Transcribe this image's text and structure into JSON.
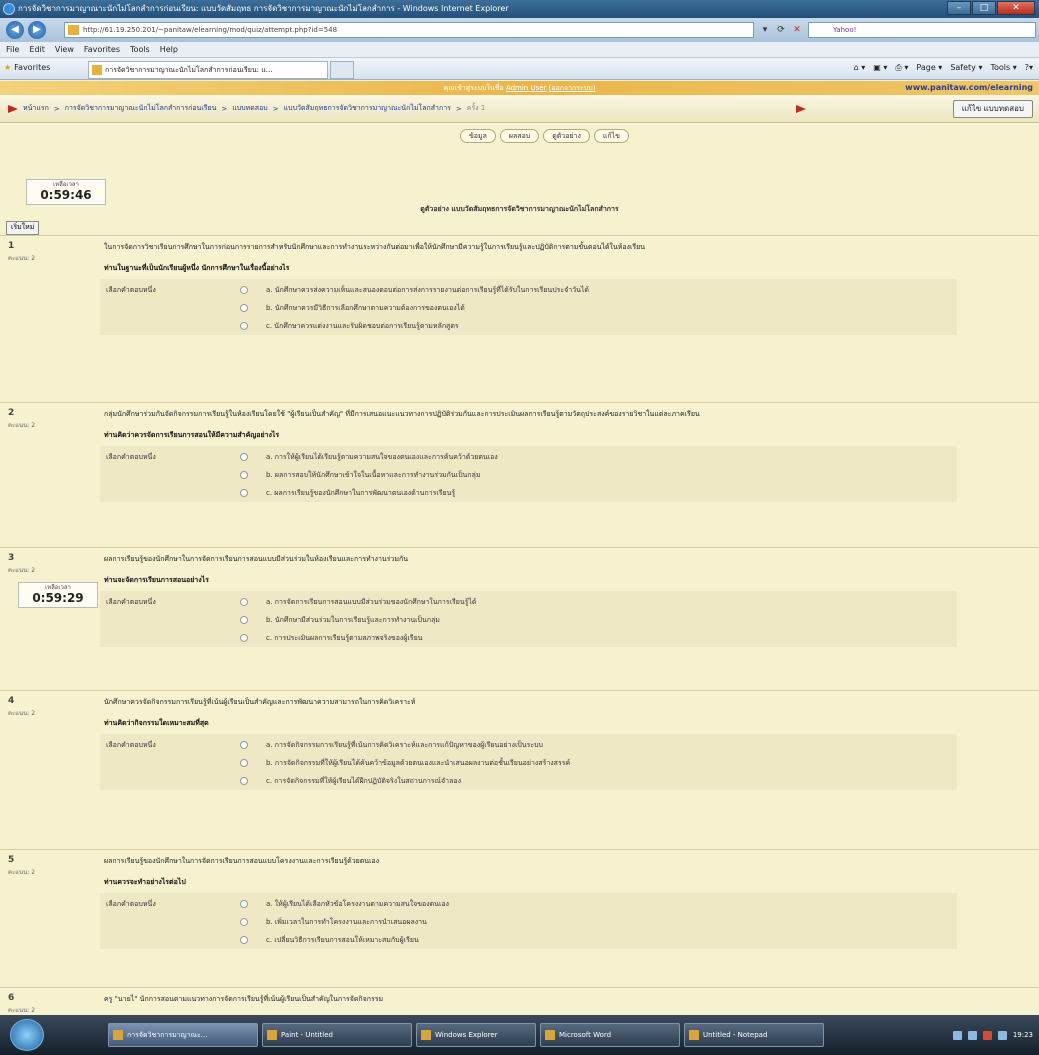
{
  "window": {
    "title": "การจัดวิชาการมาญาณาะนักไม่โลกสำการก่อนเรียน: แบบวัดสัมฤทธ การจัดวิชาการมาญาณะนักไม่โลกสำการ - Windows Internet Explorer",
    "buttons": [
      "–",
      "□",
      "✕"
    ]
  },
  "addressbar": {
    "url": "http://61.19.250.201/~panitaw/elearning/mod/quiz/attempt.php?id=548",
    "search_placeholder": "Yahoo!"
  },
  "menubar": [
    "File",
    "Edit",
    "View",
    "Favorites",
    "Tools",
    "Help"
  ],
  "favbar": {
    "favorites_label": "Favorites",
    "tab_title": "การจัดวิชาการมาญาณะนักไม่โลกสำการก่อนเรียน: แ...",
    "commands": [
      "Page ▾",
      "Safety ▾",
      "Tools ▾",
      "?▾"
    ]
  },
  "header": {
    "login_info": "คุณเข้าสู่ระบบในชื่อ",
    "login_user": "Admin User",
    "login_action": "(ออกจากระบบ)",
    "site_url": "www.panitaw.com/elearning",
    "breadcrumb": [
      "หน้าแรก",
      "การจัดวิชาการมาญาณะนักไม่โลกสำการก่อนเรียน",
      "แบบทดสอบ",
      "แบบวัดสัมฤทธการจัดวิชาการมาญาณะนักไม่โลกสำการ",
      "ครั้ง 1"
    ],
    "edit_button": "แก้ไข แบบทดสอบ"
  },
  "quiz_tabs": [
    "ข้อมูล",
    "ผลสอบ",
    "ดูตัวอย่าง",
    "แก้ไข"
  ],
  "timer1": {
    "label": "เหลือเวลา",
    "value": "0:59:46"
  },
  "timer2": {
    "label": "เหลือเวลา",
    "value": "0:59:29"
  },
  "quiz_title": "ดูตัวอย่าง แบบวัดสัมฤทธการจัดวิชาการมาญาณะนักไม่โลกสำการ",
  "save_button": "เริ่มใหม่",
  "options_label": "เลือกคำตอบหนึ่ง",
  "questions": [
    {
      "num": "1",
      "marks": "คะแนน: 2",
      "text": "ในการจัดการวิชาเรียนการศึกษาในการก่อนการรายการสำหรับนักศึกษาและการทำงานระหว่างกันต่อมาเพื่อให้นักศึกษามีความรู้ในการเรียนรู้และปฏิบัติการตามขั้นตอนได้ในห้องเรียน",
      "prompt": "ท่านในฐานะที่เป็นนักเรียนผู้หนึ่ง นักการศึกษาในเรื่องนี้อย่างไร",
      "options": [
        "a. นักศึกษาควรส่งความเห็นและสนองตอบต่อการส่งการรายงานต่อการเรียนรู้ที่ได้รับในการเรียนประจำวันได้",
        "b. นักศึกษาควรมีวิธีการเลือกศึกษาตามความต้องการของตนเองได้",
        "c. นักศึกษาควรแต่งงานและรับผิดชอบต่อการเรียนรู้ตามหลักสูตร"
      ]
    },
    {
      "num": "2",
      "marks": "คะแนน: 2",
      "text": "กลุ่มนักศึกษาร่วมกันจัดกิจกรรมการเรียนรู้ในห้องเรียนโดยใช้ \"ผู้เรียนเป็นสำคัญ\" ที่มีการเสนอแนะแนวทางการปฏิบัติร่วมกันและการประเมินผลการเรียนรู้ตามวัตถุประสงค์ของรายวิชาในแต่ละภาคเรียน",
      "prompt": "ท่านคิดว่าควรจัดการเรียนการสอนให้มีความสำคัญอย่างไร",
      "options": [
        "a. การให้ผู้เรียนได้เรียนรู้ตามความสนใจของตนเองและการค้นคว้าด้วยตนเอง",
        "b. ผลการสอบให้นักศึกษาเข้าใจในเนื้อหาและการทำงานร่วมกันเป็นกลุ่ม",
        "c. ผลการเรียนรู้ของนักศึกษาในการพัฒนาตนเองด้านการเรียนรู้"
      ]
    },
    {
      "num": "3",
      "marks": "คะแนน: 2",
      "text": "ผลการเรียนรู้ของนักศึกษาในการจัดการเรียนการสอนแบบมีส่วนร่วมในห้องเรียนและการทำงานร่วมกัน",
      "prompt": "ท่านจะจัดการเรียนการสอนอย่างไร",
      "options": [
        "a. การจัดการเรียนการสอนแบบมีส่วนร่วมของนักศึกษาในการเรียนรู้ได้",
        "b. นักศึกษามีส่วนร่วมในการเรียนรู้และการทำงานเป็นกลุ่ม",
        "c. การประเมินผลการเรียนรู้ตามสภาพจริงของผู้เรียน"
      ]
    },
    {
      "num": "4",
      "marks": "คะแนน: 2",
      "text": "นักศึกษาควรจัดกิจกรรมการเรียนรู้ที่เน้นผู้เรียนเป็นสำคัญและการพัฒนาความสามารถในการคิดวิเคราะห์",
      "prompt": "ท่านคิดว่ากิจกรรมใดเหมาะสมที่สุด",
      "options": [
        "a. การจัดกิจกรรมการเรียนรู้ที่เน้นการคิดวิเคราะห์และการแก้ปัญหาของผู้เรียนอย่างเป็นระบบ",
        "b. การจัดกิจกรรมที่ให้ผู้เรียนได้ค้นคว้าข้อมูลด้วยตนเองและนำเสนอผลงานต่อชั้นเรียนอย่างสร้างสรรค์",
        "c. การจัดกิจกรรมที่ให้ผู้เรียนได้ฝึกปฏิบัติจริงในสถานการณ์จำลอง"
      ]
    },
    {
      "num": "5",
      "marks": "คะแนน: 2",
      "text": "ผลการเรียนรู้ของนักศึกษาในการจัดการเรียนการสอนแบบโครงงานและการเรียนรู้ด้วยตนเอง",
      "prompt": "ท่านควรจะทำอย่างไรต่อไป",
      "options": [
        "a. ให้ผู้เรียนได้เลือกหัวข้อโครงงานตามความสนใจของตนเอง",
        "b. เพิ่มเวลาในการทำโครงงานและการนำเสนอผลงาน",
        "c. เปลี่ยนวิธีการเรียนการสอนให้เหมาะสมกับผู้เรียน"
      ]
    },
    {
      "num": "6",
      "marks": "คะแนน: 2",
      "text": "ครู \"นายไ\" นักการสอนตามแนวทางการจัดการเรียนรู้ที่เน้นผู้เรียนเป็นสำคัญในการจัดกิจกรรม",
      "prompt": "",
      "options": []
    }
  ],
  "taskbar": {
    "items": [
      "การจัดวิชาการมาญาณะ...",
      "Paint - Untitled",
      "Windows Explorer",
      "Microsoft Word",
      "Untitled - Notepad"
    ],
    "clock": "19:23"
  }
}
